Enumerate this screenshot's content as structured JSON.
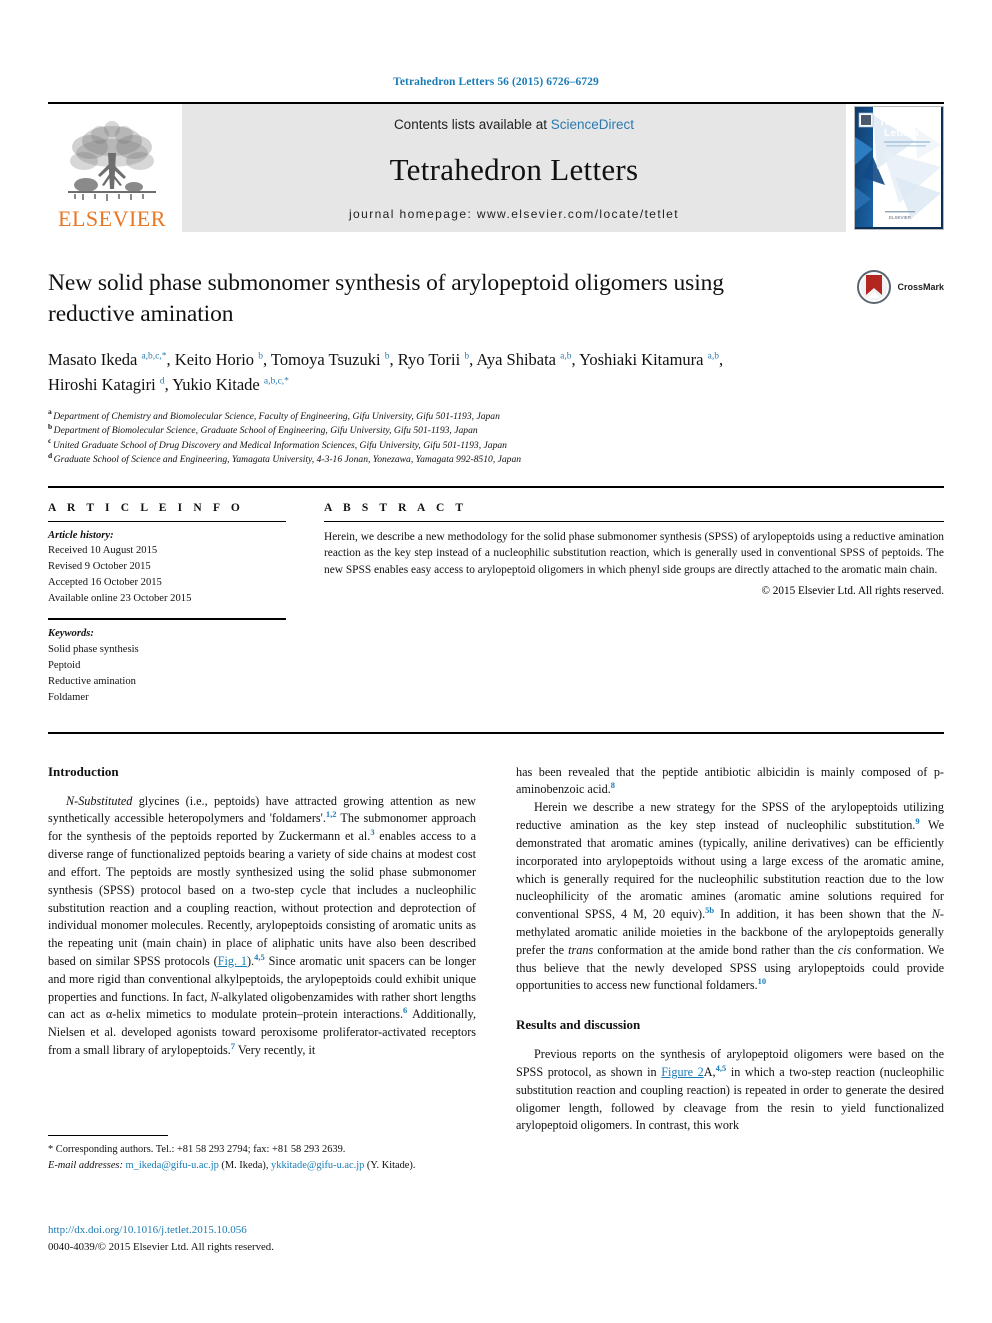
{
  "running_head": "Tetrahedron Letters 56 (2015) 6726–6729",
  "masthead": {
    "publisher_name": "ELSEVIER",
    "contents_prefix": "Contents lists available at ",
    "contents_link": "ScienceDirect",
    "journal_title": "Tetrahedron Letters",
    "homepage_line": "journal homepage: www.elsevier.com/locate/tetlet",
    "cover_title_line1": "Tetrahedron",
    "cover_title_line2": "Letters"
  },
  "article": {
    "title": "New solid phase submonomer synthesis of arylopeptoid oligomers using reductive amination",
    "crossmark_label": "CrossMark",
    "authors_line1": "Masato Ikeda a,b,c,*, Keito Horio b, Tomoya Tsuzuki b, Ryo Torii b, Aya Shibata a,b, Yoshiaki Kitamura a,b,",
    "authors_line2": "Hiroshi Katagiri d, Yukio Kitade a,b,c,*",
    "affiliations": [
      {
        "marker": "a",
        "text": "Department of Chemistry and Biomolecular Science, Faculty of Engineering, Gifu University, Gifu 501-1193, Japan"
      },
      {
        "marker": "b",
        "text": "Department of Biomolecular Science, Graduate School of Engineering, Gifu University, Gifu 501-1193, Japan"
      },
      {
        "marker": "c",
        "text": "United Graduate School of Drug Discovery and Medical Information Sciences, Gifu University, Gifu 501-1193, Japan"
      },
      {
        "marker": "d",
        "text": "Graduate School of Science and Engineering, Yamagata University, 4-3-16 Jonan, Yonezawa, Yamagata 992-8510, Japan"
      }
    ]
  },
  "article_info": {
    "heading": "A R T I C L E   I N F O",
    "history_label": "Article history:",
    "history": [
      "Received 10 August 2015",
      "Revised 9 October 2015",
      "Accepted 16 October 2015",
      "Available online 23 October 2015"
    ],
    "keywords_label": "Keywords:",
    "keywords": [
      "Solid phase synthesis",
      "Peptoid",
      "Reductive amination",
      "Foldamer"
    ]
  },
  "abstract": {
    "heading": "A B S T R A C T",
    "text": "Herein, we describe a new methodology for the solid phase submonomer synthesis (SPSS) of arylopeptoids using a reductive amination reaction as the key step instead of a nucleophilic substitution reaction, which is generally used in conventional SPSS of peptoids. The new SPSS enables easy access to arylopeptoid oligomers in which phenyl side groups are directly attached to the aromatic main chain.",
    "copyright": "© 2015 Elsevier Ltd. All rights reserved."
  },
  "body": {
    "intro_heading": "Introduction",
    "results_heading": "Results and discussion",
    "left_p1_a": "N-Substituted",
    "left_p1_b": " glycines (i.e., peptoids) have attracted growing attention as new synthetically accessible heteropolymers and 'foldamers'.",
    "left_p1_ref1": "1,2",
    "left_p1_c": " The submonomer approach for the synthesis of the peptoids reported by Zuckermann et al.",
    "left_p1_ref2": "3",
    "left_p1_d": " enables access to a diverse range of functionalized peptoids bearing a variety of side chains at modest cost and effort. The peptoids are mostly synthesized using the solid phase submonomer synthesis (SPSS) protocol based on a two-step cycle that includes a nucleophilic substitution reaction and a coupling reaction, without protection and deprotection of individual monomer molecules. Recently, arylopeptoids consisting of aromatic units as the repeating unit (main chain) in place of aliphatic units have also been described based on similar SPSS protocols (",
    "left_p1_fig": "Fig. 1",
    "left_p1_e": ").",
    "left_p1_ref3": "4,5",
    "left_p1_f": " Since aromatic unit spacers can be longer and more rigid than conventional alkylpeptoids, the arylopeptoids could exhibit unique properties and functions. In fact, ",
    "left_p1_it1": "N",
    "left_p1_g": "-alkylated oligobenzamides with rather short lengths can act as α-helix mimetics to modulate protein–protein interactions.",
    "left_p1_ref4": "6",
    "left_p1_h": " Additionally, Nielsen et al. developed agonists toward peroxisome proliferator-activated receptors from a small library of arylopeptoids.",
    "left_p1_ref5": "7",
    "left_p1_i": " Very recently, it",
    "right_p1_a": "has been revealed that the peptide antibiotic albicidin is mainly composed of p-aminobenzoic acid.",
    "right_p1_ref": "8",
    "right_p2_a": "Herein we describe a new strategy for the SPSS of the arylopeptoids utilizing reductive amination as the key step instead of nucleophilic substitution.",
    "right_p2_ref1": "9",
    "right_p2_b": " We demonstrated that aromatic amines (typically, aniline derivatives) can be efficiently incorporated into arylopeptoids without using a large excess of the aromatic amine, which is generally required for the nucleophilic substitution reaction due to the low nucleophilicity of the aromatic amines (aromatic amine solutions required for conventional SPSS, 4 M, 20 equiv).",
    "right_p2_ref2": "5b",
    "right_p2_c": " In addition, it has been shown that the ",
    "right_p2_it1": "N",
    "right_p2_d": "-methylated aromatic anilide moieties in the backbone of the arylopeptoids generally prefer the ",
    "right_p2_it2": "trans",
    "right_p2_e": " conformation at the amide bond rather than the ",
    "right_p2_it3": "cis",
    "right_p2_f": " conformation. We thus believe that the newly developed SPSS using arylopeptoids could provide opportunities to access new functional foldamers.",
    "right_p2_ref3": "10",
    "right_p3_a": "Previous reports on the synthesis of arylopeptoid oligomers were based on the SPSS protocol, as shown in ",
    "right_p3_fig": "Figure 2",
    "right_p3_b": "A,",
    "right_p3_ref1": "4,5",
    "right_p3_c": " in which a two-step reaction (nucleophilic substitution reaction and coupling reaction) is repeated in order to generate the desired oligomer length, followed by cleavage from the resin to yield functionalized arylopeptoid oligomers. In contrast, this work"
  },
  "footnotes": {
    "corresponding": "* Corresponding authors. Tel.: +81 58 293 2794; fax: +81 58 293 2639.",
    "email_label": "E-mail addresses:",
    "email1": "m_ikeda@gifu-u.ac.jp",
    "email1_owner": "(M. Ikeda),",
    "email2": "ykkitade@gifu-u.ac.jp",
    "email2_owner": "(Y. Kitade)."
  },
  "doi": {
    "url": "http://dx.doi.org/10.1016/j.tetlet.2015.10.056",
    "issn_line": "0040-4039/© 2015 Elsevier Ltd. All rights reserved."
  },
  "colors": {
    "link_blue": "#1a7cb5",
    "sciencedirect_blue": "#2a7ab0",
    "elsevier_orange": "#E87722",
    "band_gray": "#e6e6e6",
    "crossmark_red": "#b3251f"
  }
}
